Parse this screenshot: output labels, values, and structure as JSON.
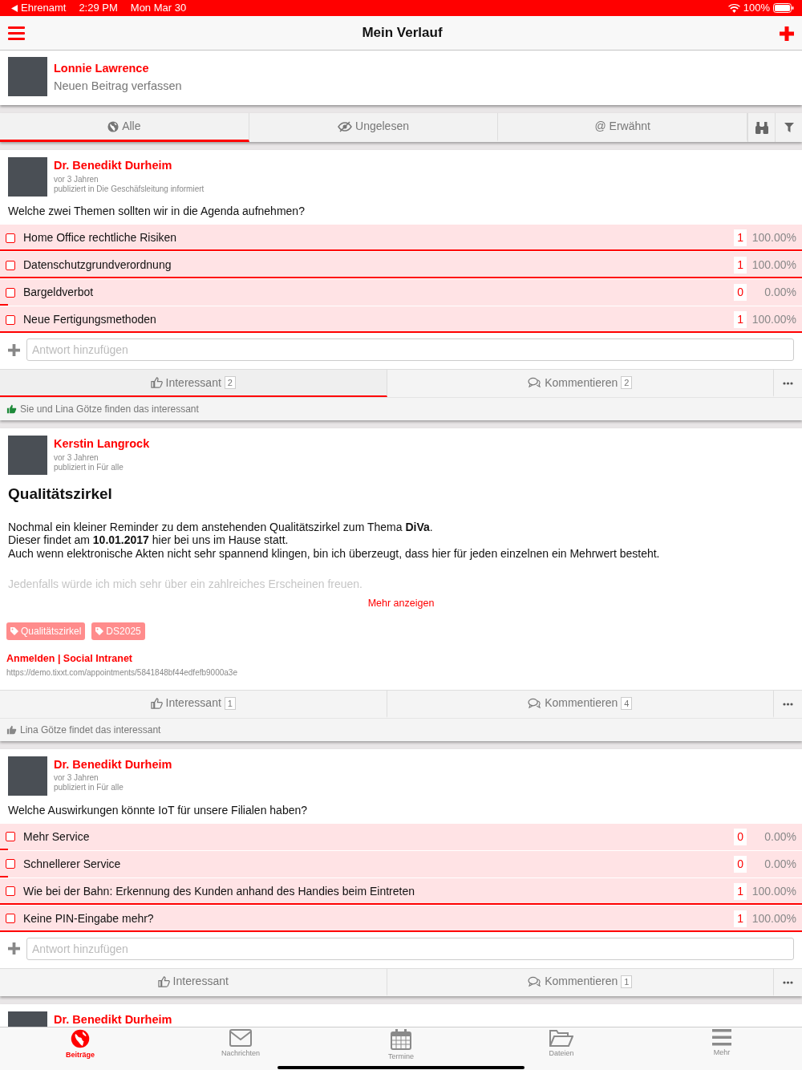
{
  "status_bar": {
    "back_app": "Ehrenamt",
    "time": "2:29 PM",
    "date": "Mon Mar 30",
    "battery": "100%"
  },
  "nav": {
    "title": "Mein Verlauf"
  },
  "composer": {
    "user": "Lonnie Lawrence",
    "prompt": "Neuen Beitrag verfassen"
  },
  "filter_tabs": [
    {
      "kind": "globe",
      "label": "Alle",
      "selected": true
    },
    {
      "kind": "unread",
      "label": "Ungelesen",
      "selected": false
    },
    {
      "kind": "mention",
      "label": "@ Erwähnt",
      "selected": false
    }
  ],
  "posts": [
    {
      "kind": "poll",
      "author": "Dr. Benedikt Durheim",
      "time": "vor 3 Jahren",
      "published": "publiziert in Die Geschäfsleitung informiert",
      "question": "Welche zwei Themen sollten wir in die Agenda aufnehmen?",
      "options": [
        {
          "label": "Home Office rechtliche Risiken",
          "checked": false,
          "count": "1",
          "percent": "100.00%",
          "level": 1
        },
        {
          "label": "Datenschutzgrundverordnung",
          "checked": false,
          "count": "1",
          "percent": "100.00%",
          "level": 1
        },
        {
          "label": "Bargeldverbot",
          "checked": false,
          "count": "0",
          "percent": "0.00%",
          "level": 0
        },
        {
          "label": "Neue Fertigungsmethoden",
          "checked": false,
          "count": "1",
          "percent": "100.00%",
          "level": 1
        }
      ],
      "answer_placeholder": "Antwort hinzufügen",
      "like_label": "Interessant",
      "like_count": "2",
      "liked": true,
      "comment_label": "Kommentieren",
      "comment_count": "2",
      "likes_note": "Sie und Lina Götze finden das interessant"
    },
    {
      "kind": "article",
      "author": "Kerstin Langrock",
      "time": "vor 3 Jahren",
      "published": "publiziert in Für alle",
      "title": "Qualitätszirkel",
      "body": [
        "Nochmal ein kleiner Reminder zu dem anstehenden Qualitätszirkel zum Thema **DiVa**.",
        "Dieser findet am **10.01.2017** hier bei uns im Hause statt.",
        "Auch wenn elektronische Akten nicht sehr spannend klingen, bin ich überzeugt, dass hier für jeden einzelnen ein Mehrwert besteht."
      ],
      "faded_text": "Jedenfalls würde ich mich sehr über ein zahlreiches Erscheinen freuen.",
      "more_link": "Mehr anzeigen",
      "tags": [
        "Qualitätszirkel",
        "DS2025"
      ],
      "link_title": "Anmelden | Social Intranet",
      "link_url": "https://demo.tixxt.com/appointments/5841848bf44edfefb9000a3e",
      "like_label": "Interessant",
      "like_count": "1",
      "liked": false,
      "comment_label": "Kommentieren",
      "comment_count": "4",
      "likes_note": "Lina Götze findet das interessant"
    },
    {
      "kind": "poll",
      "author": "Dr. Benedikt Durheim",
      "time": "vor 3 Jahren",
      "published": "publiziert in Für alle",
      "question": "Welche Auswirkungen könnte IoT für unsere Filialen haben?",
      "options": [
        {
          "label": "Mehr Service",
          "checked": false,
          "count": "0",
          "percent": "0.00%",
          "level": 0
        },
        {
          "label": "Schnellerer Service",
          "checked": false,
          "count": "0",
          "percent": "0.00%",
          "level": 0
        },
        {
          "label": "Wie bei der Bahn: Erkennung des Kunden anhand des Handies beim Eintreten",
          "checked": false,
          "count": "1",
          "percent": "100.00%",
          "level": 1
        },
        {
          "label": "Keine PIN-Eingabe mehr?",
          "checked": false,
          "count": "1",
          "percent": "100.00%",
          "level": 1
        }
      ],
      "answer_placeholder": "Antwort hinzufügen",
      "like_label": "Interessant",
      "liked": false,
      "comment_label": "Kommentieren",
      "comment_count": "1"
    },
    {
      "kind": "partial",
      "author": "Dr. Benedikt Durheim"
    }
  ],
  "tab_bar": [
    {
      "kind": "posts",
      "label": "Beiträge",
      "selected": true
    },
    {
      "kind": "messages",
      "label": "Nachrichten",
      "selected": false
    },
    {
      "kind": "calendar",
      "label": "Termine",
      "selected": false
    },
    {
      "kind": "files",
      "label": "Dateien",
      "selected": false
    },
    {
      "kind": "more",
      "label": "Mehr",
      "selected": false
    }
  ]
}
